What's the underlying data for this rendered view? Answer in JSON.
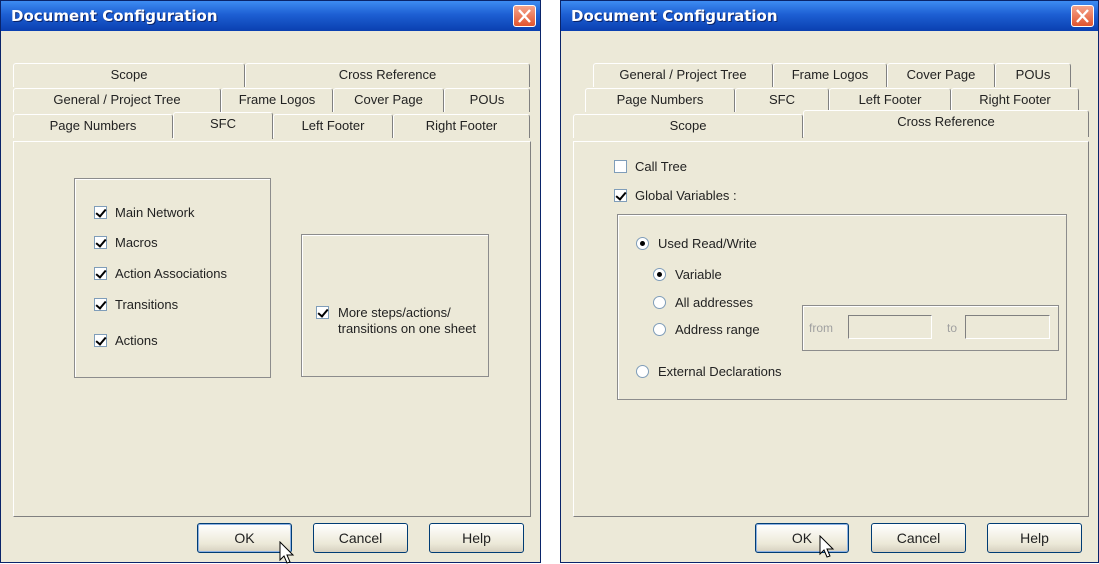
{
  "left_dialog": {
    "title": "Document Configuration",
    "tabs": [
      {
        "label": "Scope"
      },
      {
        "label": "Cross Reference"
      },
      {
        "label": "General / Project Tree"
      },
      {
        "label": "Frame Logos"
      },
      {
        "label": "Cover Page"
      },
      {
        "label": "POUs"
      },
      {
        "label": "Page Numbers"
      },
      {
        "label": "SFC"
      },
      {
        "label": "Left Footer"
      },
      {
        "label": "Right Footer"
      }
    ],
    "active_tab": "SFC",
    "checkboxes": [
      {
        "label": "Main Network",
        "checked": true
      },
      {
        "label": "Macros",
        "checked": true
      },
      {
        "label": "Action Associations",
        "checked": true
      },
      {
        "label": "Transitions",
        "checked": true
      },
      {
        "label": "Actions",
        "checked": true
      }
    ],
    "more_steps": {
      "label": "More steps/actions/ transitions on one sheet",
      "checked": true
    },
    "buttons": {
      "ok": "OK",
      "cancel": "Cancel",
      "help": "Help"
    }
  },
  "right_dialog": {
    "title": "Document Configuration",
    "tabs": [
      {
        "label": "General / Project Tree"
      },
      {
        "label": "Frame Logos"
      },
      {
        "label": "Cover Page"
      },
      {
        "label": "POUs"
      },
      {
        "label": "Page Numbers"
      },
      {
        "label": "SFC"
      },
      {
        "label": "Left Footer"
      },
      {
        "label": "Right Footer"
      },
      {
        "label": "Scope"
      },
      {
        "label": "Cross Reference"
      }
    ],
    "active_tab": "Cross Reference",
    "call_tree": {
      "label": "Call Tree",
      "checked": false
    },
    "global_variables": {
      "label": "Global Variables :",
      "checked": true
    },
    "used_read_write": {
      "label": "Used Read/Write",
      "selected": true
    },
    "variable": {
      "label": "Variable",
      "selected": true
    },
    "all_addresses": {
      "label": "All addresses",
      "selected": false
    },
    "address_range": {
      "label": "Address range",
      "selected": false
    },
    "from_label": "from",
    "to_label": "to",
    "external_declarations": {
      "label": "External Declarations",
      "selected": false
    },
    "buttons": {
      "ok": "OK",
      "cancel": "Cancel",
      "help": "Help"
    }
  }
}
